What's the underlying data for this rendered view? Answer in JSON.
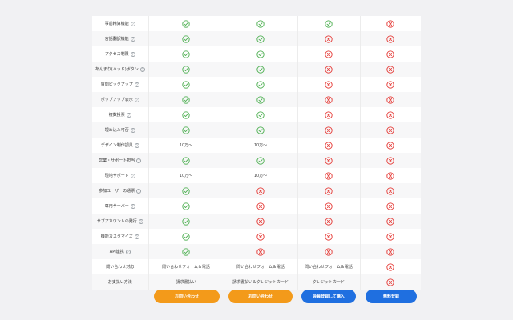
{
  "columns": [
    "",
    "",
    "",
    ""
  ],
  "rows": [
    {
      "label": "事前精算機能",
      "help": true,
      "cells": [
        "check",
        "check",
        "check",
        "cross"
      ]
    },
    {
      "label": "言語翻訳機能",
      "help": true,
      "cells": [
        "check",
        "check",
        "cross",
        "cross"
      ]
    },
    {
      "label": "アクセス制限",
      "help": true,
      "cells": [
        "check",
        "check",
        "cross",
        "cross"
      ]
    },
    {
      "label": "あんまり(ハッド)ボタン",
      "help": true,
      "cells": [
        "check",
        "check",
        "cross",
        "cross"
      ]
    },
    {
      "label": "質問ピックアップ",
      "help": true,
      "cells": [
        "check",
        "check",
        "cross",
        "cross"
      ]
    },
    {
      "label": "ポップアップ表示",
      "help": true,
      "cells": [
        "check",
        "check",
        "cross",
        "cross"
      ]
    },
    {
      "label": "複数投票",
      "help": true,
      "cells": [
        "check",
        "check",
        "cross",
        "cross"
      ]
    },
    {
      "label": "埋め込み可否",
      "help": true,
      "cells": [
        "check",
        "check",
        "cross",
        "cross"
      ]
    },
    {
      "label": "デザイン制作調具",
      "help": true,
      "cells": [
        "10万〜",
        "10万〜",
        "cross",
        "cross"
      ]
    },
    {
      "label": "営業・サポート担当",
      "help": true,
      "cells": [
        "check",
        "check",
        "cross",
        "cross"
      ]
    },
    {
      "label": "現地サポート",
      "help": true,
      "cells": [
        "10万〜",
        "10万〜",
        "cross",
        "cross"
      ]
    },
    {
      "label": "参加ユーザーの通票",
      "help": true,
      "cells": [
        "check",
        "cross",
        "cross",
        "cross"
      ]
    },
    {
      "label": "専用サーバー",
      "help": true,
      "cells": [
        "check",
        "cross",
        "cross",
        "cross"
      ]
    },
    {
      "label": "サブアカウントの発行",
      "help": true,
      "cells": [
        "check",
        "cross",
        "cross",
        "cross"
      ]
    },
    {
      "label": "機能カスタマイズ",
      "help": true,
      "cells": [
        "check",
        "cross",
        "cross",
        "cross"
      ]
    },
    {
      "label": "API連携",
      "help": true,
      "cells": [
        "check",
        "cross",
        "cross",
        "cross"
      ]
    },
    {
      "label": "問い合わせ対応",
      "help": false,
      "cells": [
        "問い合わせフォーム＆電話",
        "問い合わせフォーム＆電話",
        "問い合わせフォーム＆電話",
        "cross"
      ]
    },
    {
      "label": "お支払い方法",
      "help": false,
      "cells": [
        "請求書払い",
        "請求書払い＆クレジットカード",
        "クレジットカード",
        "cross"
      ]
    }
  ],
  "buttons": [
    {
      "label": "お問い合わせ",
      "style": "orange"
    },
    {
      "label": "お問い合わせ",
      "style": "orange"
    },
    {
      "label": "会員登録して購入",
      "style": "blue"
    },
    {
      "label": "無料登録",
      "style": "blue"
    }
  ],
  "help_glyph": "?",
  "colors": {
    "check": "#4caf50",
    "cross": "#e53935",
    "orange": "#f39a1a",
    "blue": "#1f6fe0",
    "background": "#f1f1f3"
  }
}
